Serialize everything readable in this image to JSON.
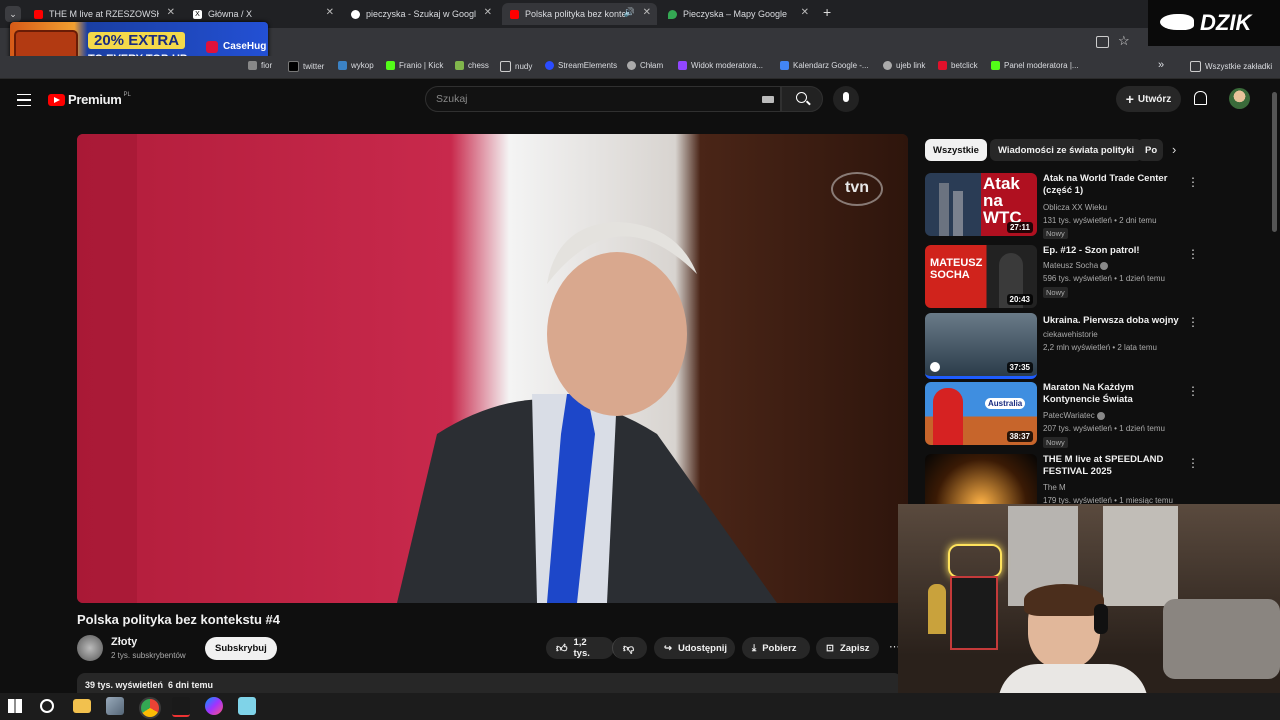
{
  "tabs": [
    {
      "title": "THE M live at RZESZOWSKIE JU",
      "color": "#ff0000"
    },
    {
      "title": "Główna / X",
      "color": "#000000"
    },
    {
      "title": "pieczyska - Szukaj w Google",
      "color": "#4285f4"
    },
    {
      "title": "Polska polityka bez konteks",
      "color": "#ff0000",
      "active": true
    },
    {
      "title": "Pieczyska – Mapy Google",
      "color": "#34a853"
    }
  ],
  "new_tab": "+",
  "ad": {
    "line1": "20% EXTRA",
    "line2": "TO EVERY TOP-UP",
    "brand": "CaseHug"
  },
  "dzik": "DZIK",
  "bookmarks": [
    {
      "label": "fior",
      "color": "#888"
    },
    {
      "label": "twitter",
      "color": "#000"
    },
    {
      "label": "wykop",
      "color": "#3b82c4"
    },
    {
      "label": "Franio | Kick",
      "color": "#53fc18"
    },
    {
      "label": "chess",
      "color": "#81b64c"
    },
    {
      "label": "nudy",
      "color": "#777"
    },
    {
      "label": "StreamElements",
      "color": "#2b4cff"
    },
    {
      "label": "Chłam",
      "color": "#aaa"
    },
    {
      "label": "Widok moderatora...",
      "color": "#9146ff"
    },
    {
      "label": "Kalendarz Google -...",
      "color": "#4285f4"
    },
    {
      "label": "ujeb link",
      "color": "#aaa"
    },
    {
      "label": "betclick",
      "color": "#e0112b"
    },
    {
      "label": "Panel moderatora |...",
      "color": "#53fc18"
    }
  ],
  "bookmarks_more": "»",
  "all_bookmarks": "Wszystkie zakładki",
  "yt": {
    "logo": "Premium",
    "region": "PL",
    "search_placeholder": "Szukaj",
    "create": "Utwórz"
  },
  "video": {
    "title": "Polska polityka bez kontekstu #4",
    "channel": "Złoty",
    "subs": "2 tys. subskrybentów",
    "subscribe": "Subskrybuj",
    "likes": "1,2 tys.",
    "share": "Udostępnij",
    "download": "Pobierz",
    "save": "Zapisz",
    "stats": "39 tys. wyświetleń  6 dni temu",
    "watermark": "tvn"
  },
  "chips": [
    "Wszystkie",
    "Wiadomości ze świata polityki",
    "Po"
  ],
  "recommended": [
    {
      "title": "Atak na World Trade Center (część 1)",
      "channel": "Oblicza XX Wieku",
      "meta": "131 tys. wyświetleń • 2 dni temu",
      "badge": "Nowy",
      "duration": "27:11",
      "thumb_text": "Atak na WTC",
      "verified": false
    },
    {
      "title": "Ep. #12 - Szon patrol!",
      "channel": "Mateusz Socha",
      "meta": "596 tys. wyświetleń • 1 dzień temu",
      "badge": "Nowy",
      "duration": "20:43",
      "thumb_text": "MATEUSZ SOCHA",
      "verified": true
    },
    {
      "title": "Ukraina. Pierwsza doba wojny",
      "channel": "ciekawehistorie",
      "meta": "2,2 mln wyświetleń • 2 lata temu",
      "badge": "",
      "duration": "37:35",
      "thumb_text": "",
      "verified": false
    },
    {
      "title": "Maraton Na Każdym Kontynencie Świata",
      "channel": "PatecWariatec",
      "meta": "207 tys. wyświetleń • 1 dzień temu",
      "badge": "Nowy",
      "duration": "38:37",
      "thumb_text": "Australia",
      "verified": true
    },
    {
      "title": "THE M live at SPEEDLAND FESTIVAL 2025",
      "channel": "The M",
      "meta": "179 tys. wyświetleń • 1 miesiąc temu",
      "badge": "",
      "duration": "",
      "thumb_text": "",
      "verified": false
    }
  ]
}
